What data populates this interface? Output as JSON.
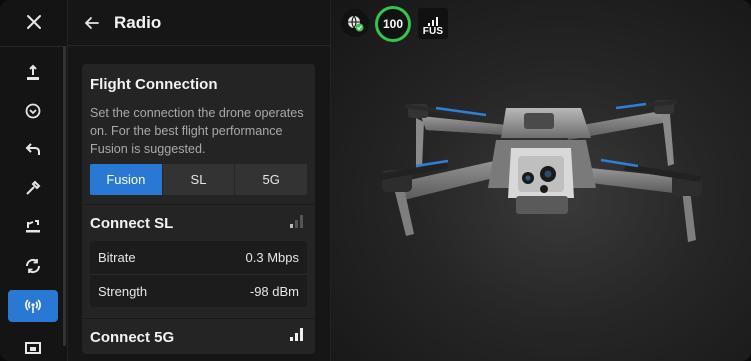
{
  "panel": {
    "title": "Radio"
  },
  "flight_connection": {
    "title": "Flight Connection",
    "description": "Set the connection the drone operates on. For the best flight performance Fusion is suggested.",
    "options": [
      "Fusion",
      "SL",
      "5G"
    ],
    "selected": "Fusion"
  },
  "connect_sl": {
    "title": "Connect SL",
    "rows": [
      {
        "label": "Bitrate",
        "value": "0.3 Mbps"
      },
      {
        "label": "Strength",
        "value": "-98 dBm"
      }
    ]
  },
  "connect_5g": {
    "title": "Connect 5G"
  },
  "hud": {
    "battery": "100",
    "link_mode": "FUS"
  },
  "colors": {
    "accent": "#2979d4",
    "battery_ring": "#35c34a"
  }
}
